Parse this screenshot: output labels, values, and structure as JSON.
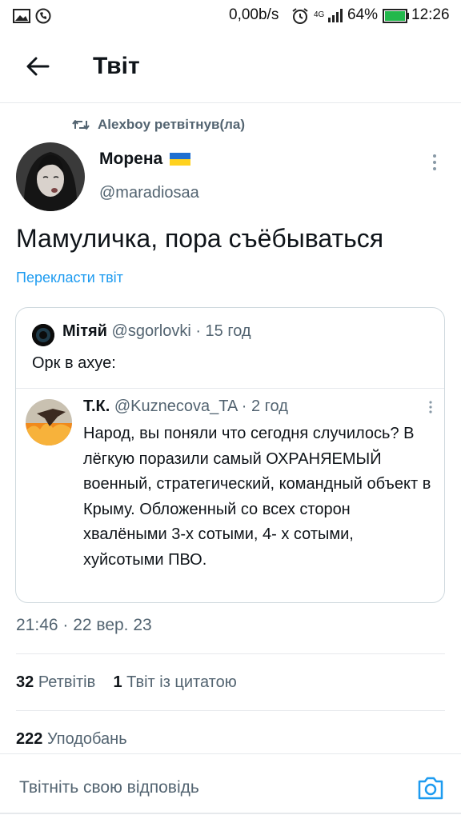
{
  "status_bar": {
    "speed": "0,00b/s",
    "network": "4G",
    "battery": "64%",
    "time": "12:26",
    "icons": [
      "image-icon",
      "viber-icon",
      "alarm-icon",
      "signal-icon",
      "battery-icon"
    ]
  },
  "header": {
    "title": "Твіт"
  },
  "retweet": {
    "text": "Alexboy ретвітнув(ла)"
  },
  "tweet": {
    "author_name": "Морена",
    "author_handle": "@maradiosaa",
    "text": "Мамуличка, пора съёбываться",
    "translate": "Перекласти твіт",
    "timestamp": "21:46 · 22 вер. 23"
  },
  "quote": {
    "name": "Мітяй",
    "handle": "@sgorlovki",
    "time": "· 15 год",
    "text": "Орк в ахуе:",
    "inner": {
      "name": "Т.К.",
      "handle": "@Kuznecova_TA",
      "time": "· 2 год",
      "text": "Народ, вы поняли что сегодня случилось? В лёгкую поразили самый ОХРАНЯЕМЫЙ военный, стратегический, командный объект в Крыму. Обложенный со всех сторон хвалёными 3-х сотыми, 4- х сотыми, хуйсотыми ПВО."
    }
  },
  "stats": {
    "retweets_count": "32",
    "retweets_label": "Ретвітів",
    "quotes_count": "1",
    "quotes_label": "Твіт із цитатою",
    "likes_count": "222",
    "likes_label": "Уподобань"
  },
  "reply": {
    "placeholder": "Твітніть свою відповідь"
  },
  "colors": {
    "accent": "#1d9bf0",
    "muted": "#536471",
    "text": "#0f1419"
  }
}
